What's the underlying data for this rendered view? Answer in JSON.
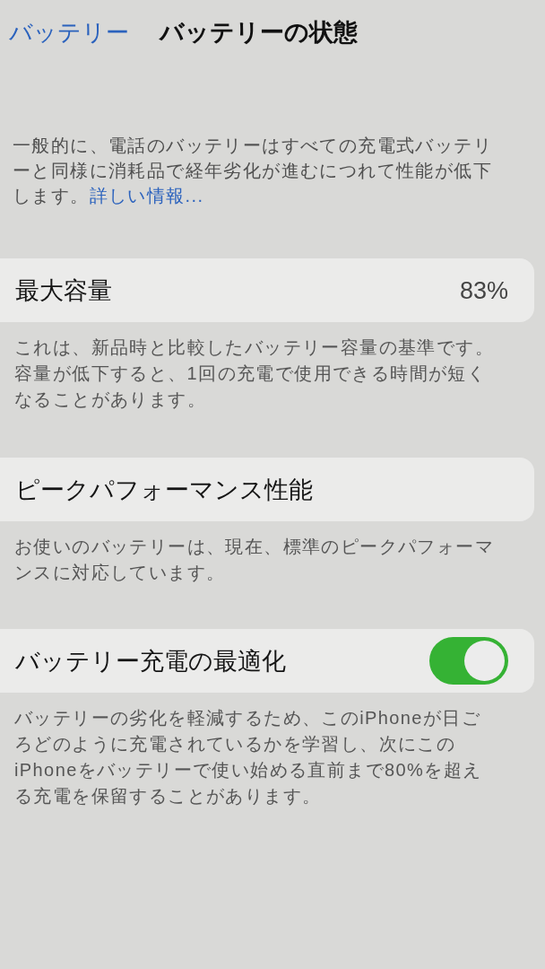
{
  "nav": {
    "back_label": "バッテリー",
    "title": "バッテリーの状態"
  },
  "intro": {
    "text": "一般的に、電話のバッテリーはすべての充電式バッテリーと同様に消耗品で経年劣化が進むにつれて性能が低下します。",
    "link": "詳しい情報..."
  },
  "sections": [
    {
      "kind": "value",
      "label": "最大容量",
      "value": "83%",
      "footer": "これは、新品時と比較したバッテリー容量の基準です。容量が低下すると、1回の充電で使用できる時間が短くなることがあります。"
    },
    {
      "kind": "plain",
      "label": "ピークパフォーマンス性能",
      "footer": "お使いのバッテリーは、現在、標準のピークパフォーマンスに対応しています。"
    },
    {
      "kind": "toggle",
      "label": "バッテリー充電の最適化",
      "on": true,
      "footer": "バッテリーの劣化を軽減するため、このiPhoneが日ごろどのように充電されているかを学習し、次にこのiPhoneをバッテリーで使い始める直前まで80%を超える充電を保留することがあります。"
    }
  ]
}
